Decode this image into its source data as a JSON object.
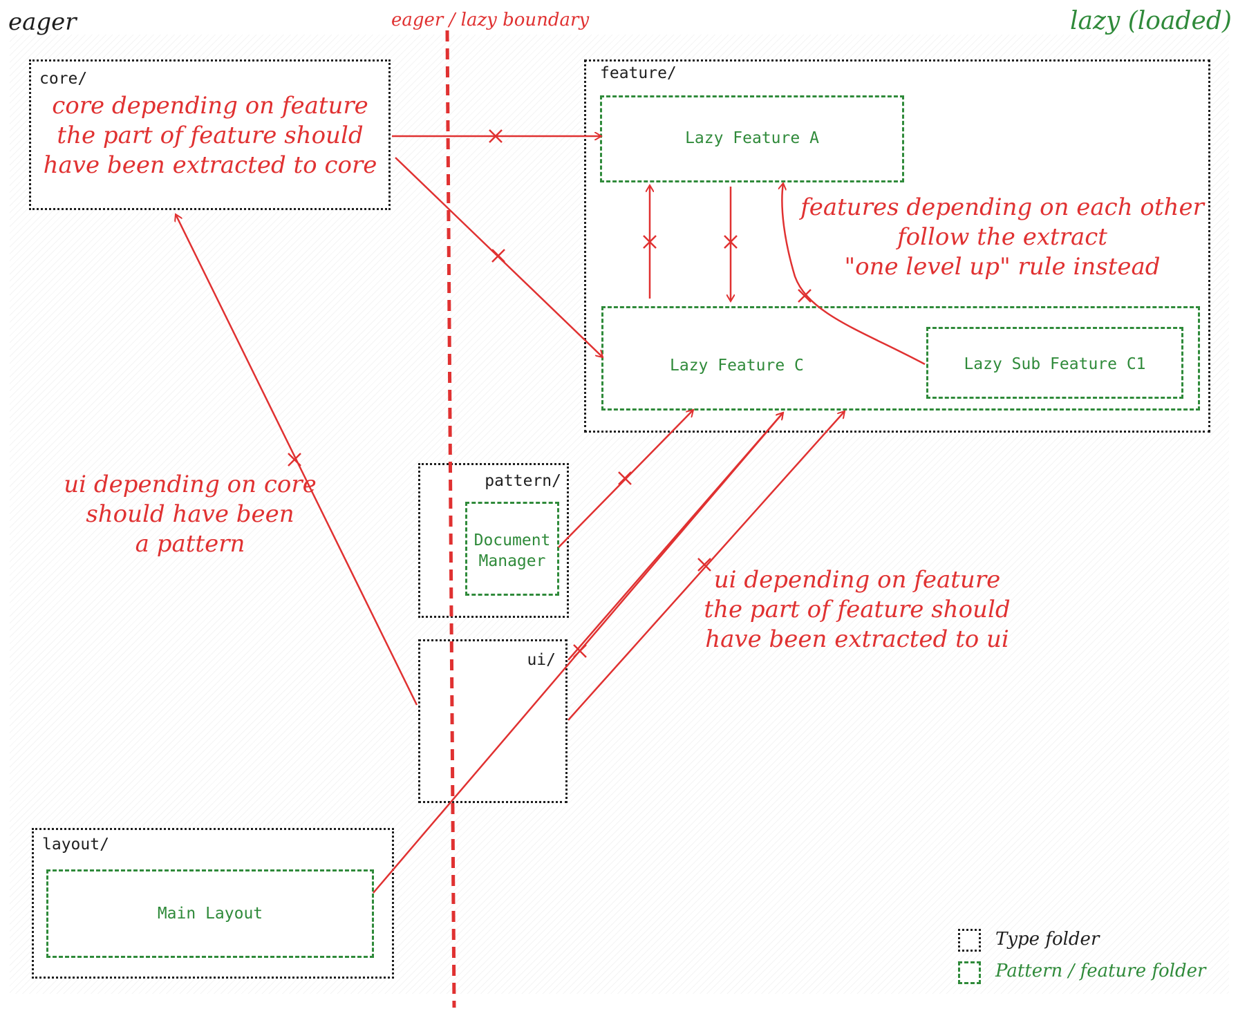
{
  "corners": {
    "left": "eager",
    "boundary": "eager / lazy boundary",
    "right": "lazy (loaded)"
  },
  "folders": {
    "core": "core/",
    "feature": "feature/",
    "pattern": "pattern/",
    "ui": "ui/",
    "layout": "layout/"
  },
  "features": {
    "lazy_a": "Lazy Feature A",
    "lazy_c": "Lazy Feature C",
    "lazy_sub_c1": "Lazy Sub Feature C1",
    "document_manager": "Document\nManager",
    "main_layout": "Main Layout"
  },
  "notes": {
    "core_feature": "core depending on feature\nthe part of feature should\nhave been extracted to core",
    "features_each_other": "features depending on each other\nfollow the extract\n\"one level up\" rule instead",
    "ui_core": "ui depending on core\nshould have been\na pattern",
    "ui_feature": "ui depending on feature\nthe part of feature should\nhave been extracted to ui"
  },
  "legend": {
    "type_folder": "Type folder",
    "pattern_feature_folder": "Pattern / feature folder"
  },
  "colors": {
    "red": "#e03131",
    "green": "#2f8a3a",
    "black": "#1e1e1e"
  }
}
